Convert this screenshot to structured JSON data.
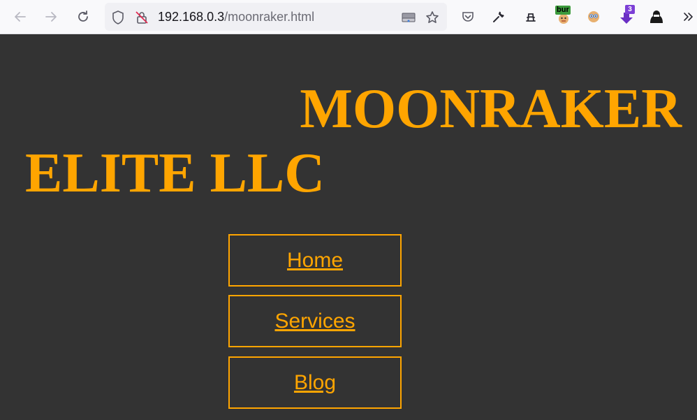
{
  "browser": {
    "url_host": "192.168.0.3",
    "url_path": "/moonraker.html",
    "back_icon": "arrow-left-icon",
    "forward_icon": "arrow-right-icon",
    "reload_icon": "reload-icon",
    "extension_badges": {
      "bur": "bur",
      "count": "3"
    }
  },
  "page": {
    "title_line1": "MOONRAKER",
    "title_line2": "ELITE LLC",
    "nav": [
      {
        "label": "Home"
      },
      {
        "label": "Services"
      },
      {
        "label": "Blog"
      }
    ],
    "colors": {
      "background": "#333333",
      "accent": "#ffa500"
    }
  }
}
